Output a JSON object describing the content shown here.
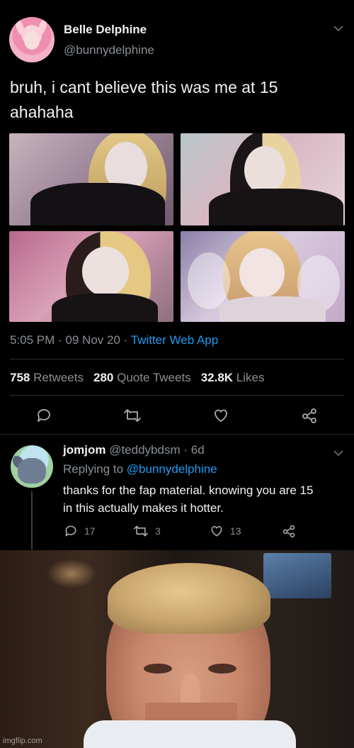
{
  "tweet": {
    "display_name": "Belle Delphine",
    "handle": "@bunnydelphine",
    "text_line1": "bruh, i cant believe this was me at 15",
    "text_line2": "ahahaha",
    "time": "5:05 PM",
    "date": "09 Nov 20",
    "separator": " · ",
    "source": "Twitter Web App",
    "stats": {
      "retweets_count": "758",
      "retweets_label": "Retweets",
      "quotes_count": "280",
      "quotes_label": "Quote Tweets",
      "likes_count": "32.8K",
      "likes_label": "Likes"
    }
  },
  "reply": {
    "display_name": "jomjom",
    "handle": "@teddybdsm",
    "age": "6d",
    "replying_label": "Replying to",
    "replying_to": "@bunnydelphine",
    "text_line1": "thanks for the fap material. knowing you are 15",
    "text_line2": "in this actually makes it hotter.",
    "replies": "17",
    "retweets": "3",
    "likes": "13"
  },
  "watermark": "imgflip.com",
  "colors": {
    "accent": "#1d9bf0",
    "muted": "#8a8f94",
    "text": "#f1f1f1"
  }
}
